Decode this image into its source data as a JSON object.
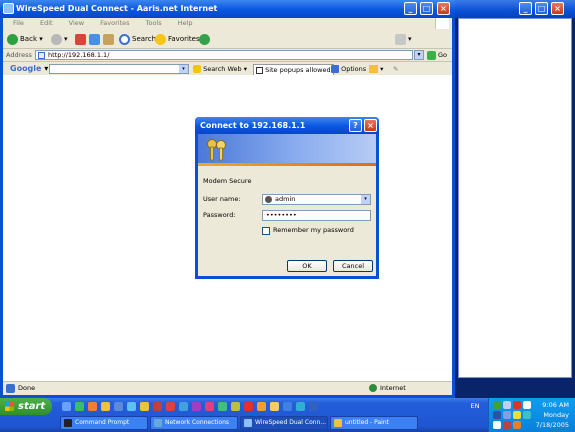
{
  "ie": {
    "title": "WireSpeed Dual Connect - Aaris.net Internet",
    "menu": [
      "File",
      "Edit",
      "View",
      "Favorites",
      "Tools",
      "Help"
    ],
    "toolbar": {
      "back": "Back",
      "search": "Search",
      "favorites": "Favorites"
    },
    "address": {
      "label": "Address",
      "value": "http://192.168.1.1/",
      "go": "Go"
    },
    "googlebar": {
      "logo": "Google",
      "search_web": "Search Web",
      "popups": "Site popups allowed",
      "options": "Options"
    },
    "status": {
      "left": "Done",
      "zone": "Internet"
    }
  },
  "dialog": {
    "title": "Connect to 192.168.1.1",
    "realm": "Modem Secure",
    "username_label": "User name:",
    "username_value": "admin",
    "password_label": "Password:",
    "password_value": "••••••••",
    "remember_label": "Remember my password",
    "ok": "OK",
    "cancel": "Cancel"
  },
  "taskbar": {
    "start": "start",
    "tasks": [
      "Command Prompt",
      "Network Connections",
      "WireSpeed Dual Conn...",
      "untitled - Paint"
    ],
    "lang": "EN",
    "clock": {
      "time": "9:06 AM",
      "day": "Monday",
      "date": "7/18/2005"
    }
  }
}
